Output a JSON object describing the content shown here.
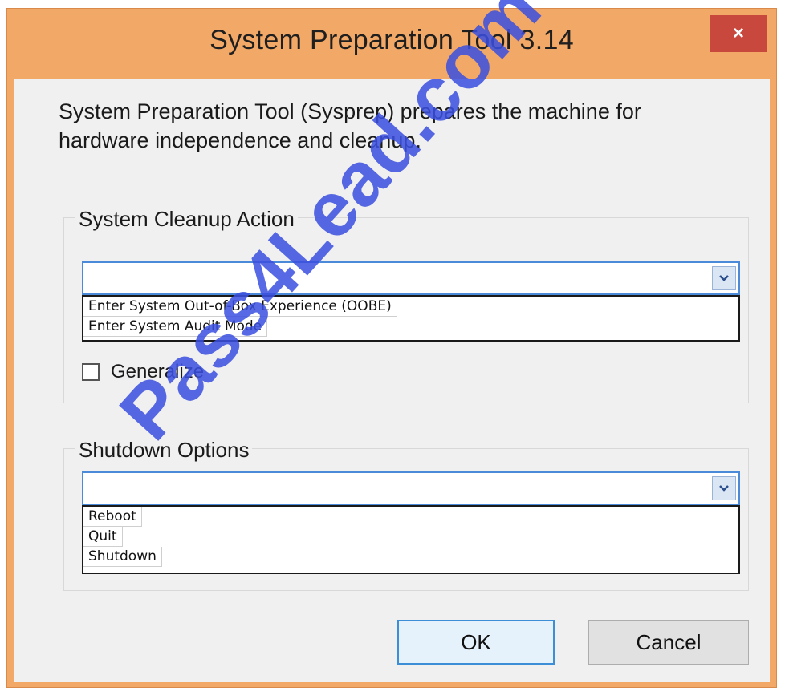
{
  "window": {
    "title": "System Preparation Tool 3.14",
    "close_label": "×"
  },
  "description": "System Preparation Tool (Sysprep) prepares the machine for hardware independence and cleanup.",
  "cleanup": {
    "group_label": "System Cleanup Action",
    "selected_value": "",
    "options": [
      "Enter System Out-of-Box Experience (OOBE)",
      "Enter System Audit Mode"
    ],
    "generalize_label": "Generalize",
    "generalize_checked": false
  },
  "shutdown": {
    "group_label": "Shutdown Options",
    "selected_value": "",
    "options": [
      "Reboot",
      "Quit",
      "Shutdown"
    ]
  },
  "buttons": {
    "ok": "OK",
    "cancel": "Cancel"
  },
  "watermark": "Pass4Lead.com",
  "colors": {
    "frame": "#f2a866",
    "close_button": "#c9483e",
    "combo_border": "#4a8ad8",
    "watermark": "#3a4fe0"
  },
  "icons": {
    "combo_arrow": "chevron-down-icon",
    "close": "close-icon"
  }
}
